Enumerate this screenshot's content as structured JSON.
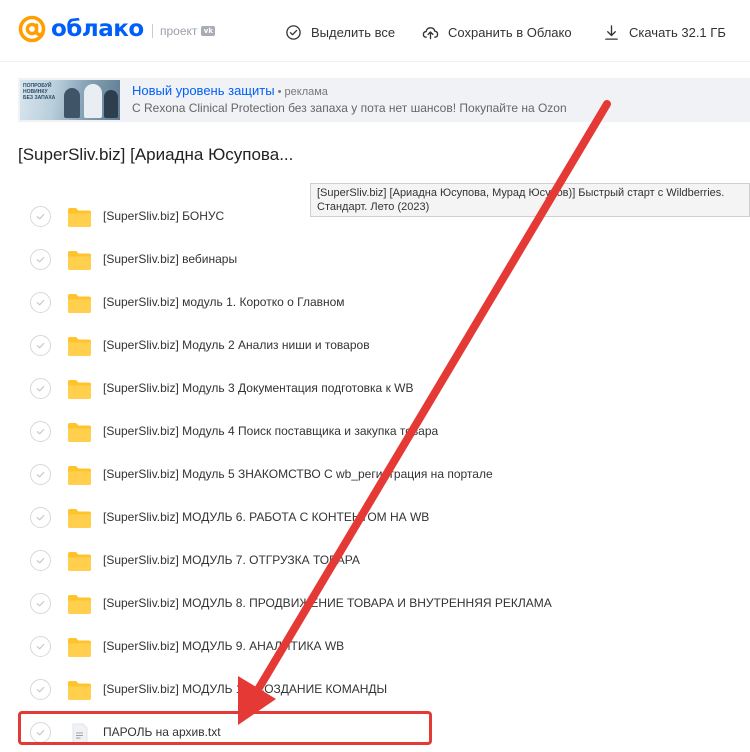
{
  "header": {
    "logo_text": "облако",
    "project_label": "проект",
    "vk_badge": "vk",
    "select_all_label": "Выделить все",
    "save_label": "Сохранить в Облако",
    "download_label": "Скачать 32.1 ГБ"
  },
  "ad": {
    "image_text": "ПОПРОБУЙ НОВИНКУ БЕЗ ЗАПАХА",
    "title": "Новый уровень защиты",
    "tag": " • реклама",
    "description": "C Rexona Clinical Protection без запаха у пота нет шансов! Покупайте на Ozon"
  },
  "folder": {
    "title": "[SuperSliv.biz] [Ариадна Юсупова..."
  },
  "tooltip": {
    "line1": "[SuperSliv.biz] [Ариадна Юсупова, Мурад Юсупов)] Быстрый старт с Wildberries.",
    "line2": "Стандарт. Лето (2023)"
  },
  "files": [
    {
      "type": "folder",
      "name": "[SuperSliv.biz] БОНУС"
    },
    {
      "type": "folder",
      "name": "[SuperSliv.biz] вебинары"
    },
    {
      "type": "folder",
      "name": "[SuperSliv.biz] модуль 1. Коротко о Главном"
    },
    {
      "type": "folder",
      "name": "[SuperSliv.biz] Модуль 2 Анализ ниши и товаров"
    },
    {
      "type": "folder",
      "name": "[SuperSliv.biz] Модуль 3 Документация подготовка к WB"
    },
    {
      "type": "folder",
      "name": "[SuperSliv.biz] Модуль 4 Поиск поставщика и закупка товара"
    },
    {
      "type": "folder",
      "name": "[SuperSliv.biz] Модуль 5 ЗНАКОМСТВО С wb_регистрация на портале"
    },
    {
      "type": "folder",
      "name": "[SuperSliv.biz] МОДУЛЬ 6. РАБОТА С КОНТЕНТОМ НА WB"
    },
    {
      "type": "folder",
      "name": "[SuperSliv.biz] МОДУЛЬ 7. ОТГРУЗКА ТОВАРА"
    },
    {
      "type": "folder",
      "name": "[SuperSliv.biz] МОДУЛЬ 8. ПРОДВИЖЕНИЕ ТОВАРА И ВНУТРЕННЯЯ РЕКЛАМА"
    },
    {
      "type": "folder",
      "name": "[SuperSliv.biz] МОДУЛЬ 9. АНАЛИТИКА WB"
    },
    {
      "type": "folder",
      "name": "[SuperSliv.biz] МОДУЛЬ 10. СОЗДАНИЕ КОМАНДЫ"
    },
    {
      "type": "file",
      "name": "ПАРОЛЬ на архив.txt"
    }
  ],
  "colors": {
    "brand_blue": "#005ff9",
    "logo_orange": "#ff9e00",
    "folder_yellow": "#ffc42b",
    "annotation_red": "#e53935"
  },
  "icons": [
    "check-circle-icon",
    "cloud-upload-icon",
    "download-icon",
    "checkmark-icon",
    "folder-icon",
    "text-file-icon"
  ]
}
